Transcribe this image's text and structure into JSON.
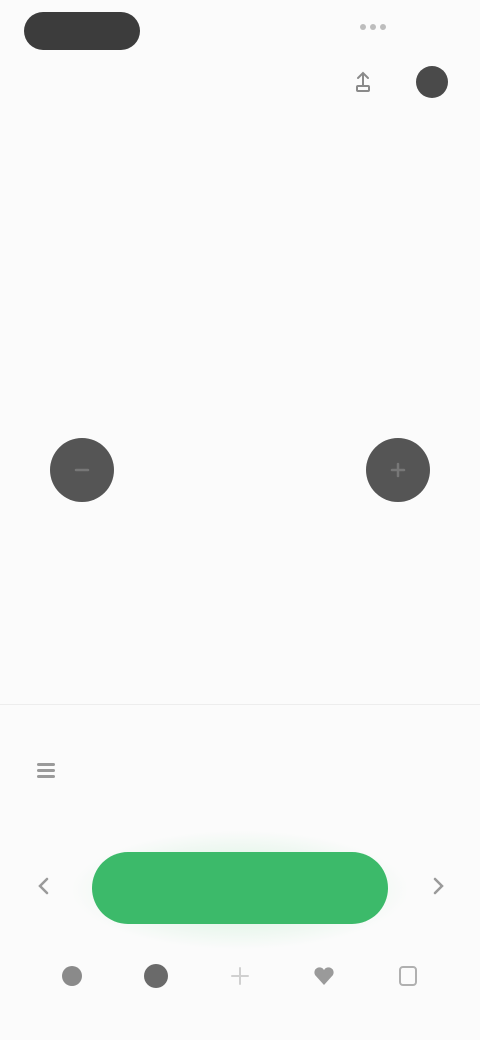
{
  "status_bar": {
    "time": "",
    "indicator": ""
  },
  "header": {
    "caption": "",
    "headline": ""
  },
  "center": {
    "label": "",
    "value": "",
    "sub": "",
    "link": ""
  },
  "row": {
    "text": ""
  },
  "primary_button": {
    "label": ""
  },
  "tabs": [
    {
      "label": "",
      "icon": "home-icon"
    },
    {
      "label": "",
      "icon": "chart-icon"
    },
    {
      "label": "",
      "icon": "plus-icon"
    },
    {
      "label": "",
      "icon": "heart-icon"
    },
    {
      "label": "",
      "icon": "profile-icon"
    }
  ],
  "colors": {
    "accent": "#3cba6a",
    "dark_button": "#555555",
    "background": "#fbfbfb"
  }
}
